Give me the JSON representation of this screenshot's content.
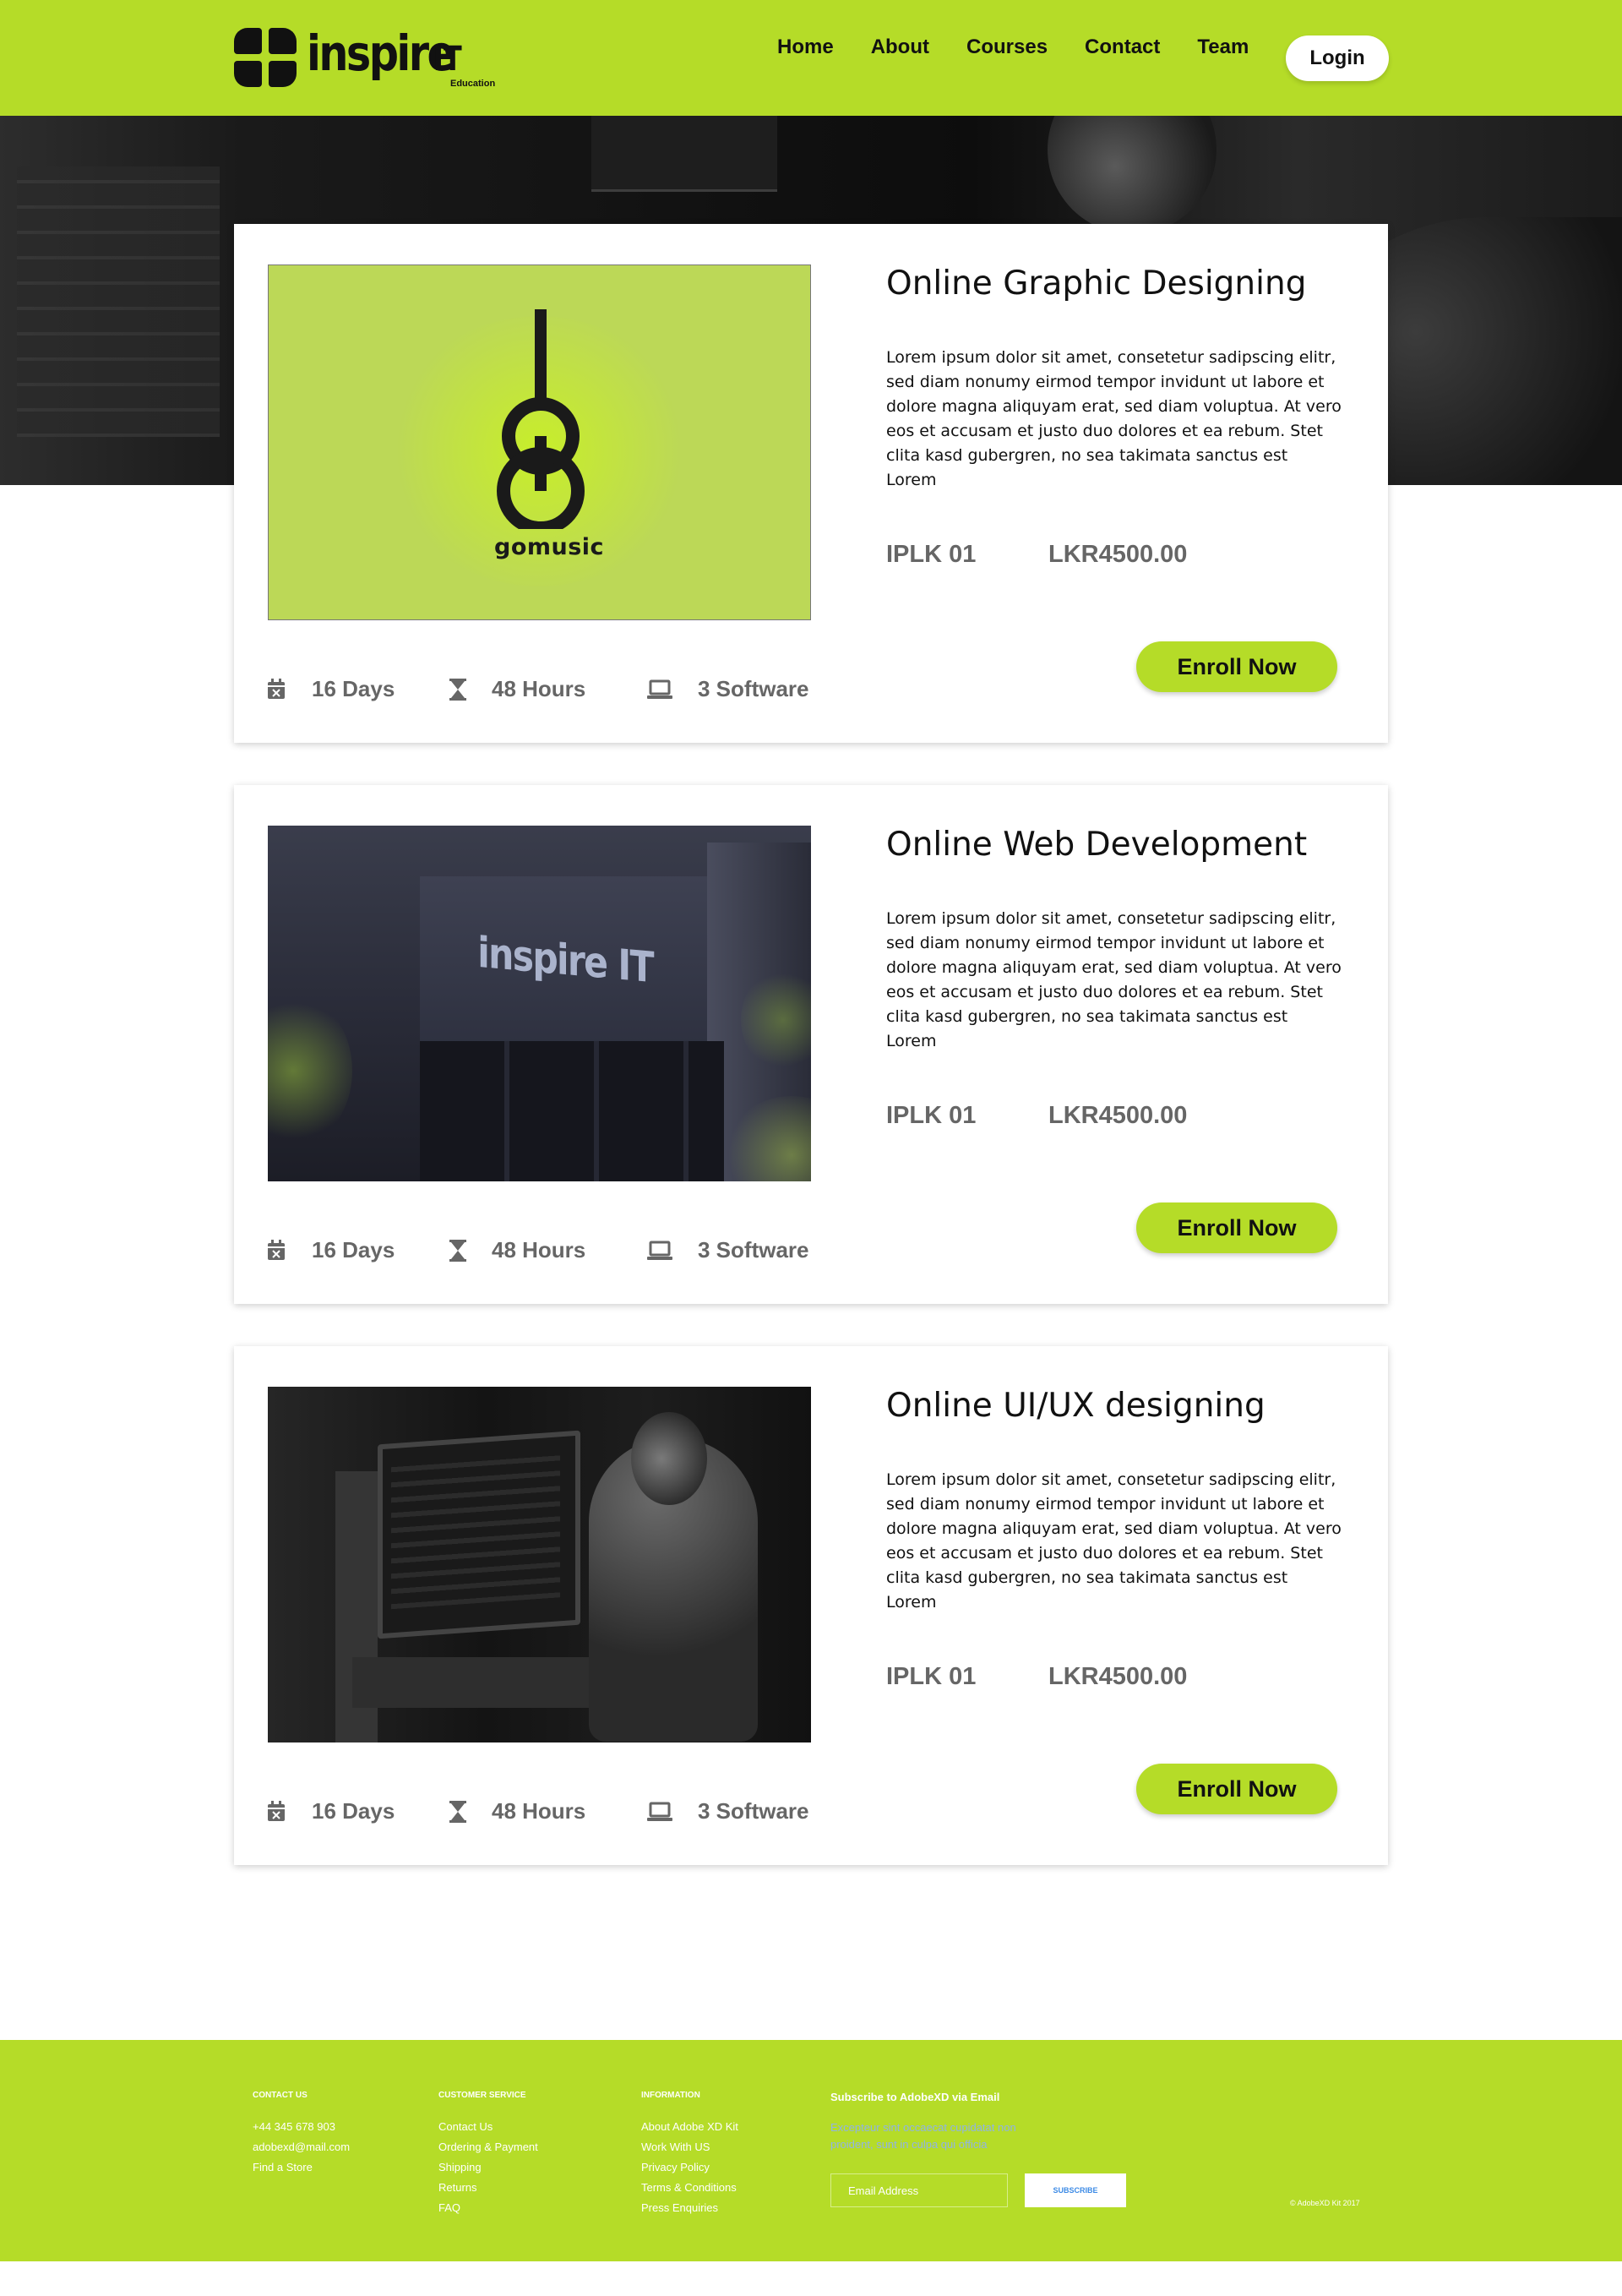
{
  "header": {
    "logo": {
      "word": "inspire",
      "suffix": "IT",
      "tagline": "Education"
    },
    "nav": [
      "Home",
      "About",
      "Courses",
      "Contact",
      "Team"
    ],
    "login_label": "Login",
    "brand_color": "#b5dc28"
  },
  "courses": [
    {
      "title": "Online Graphic Designing",
      "description": "Lorem ipsum dolor sit amet, consetetur sadipscing elitr, sed diam nonumy eirmod tempor invidunt ut labore et dolore magna aliquyam erat, sed diam voluptua. At vero eos et accusam et justo duo dolores et ea rebum. Stet clita kasd gubergren, no sea takimata sanctus est Lorem",
      "code": "IPLK 01",
      "price": "LKR4500.00",
      "enroll_label": "Enroll Now",
      "days": "16 Days",
      "hours": "48 Hours",
      "software": "3 Software",
      "image_label": "gomusic"
    },
    {
      "title": "Online Web Development",
      "description": "Lorem ipsum dolor sit amet, consetetur sadipscing elitr, sed diam nonumy eirmod tempor invidunt ut labore et dolore magna aliquyam erat, sed diam voluptua. At vero eos et accusam et justo duo dolores et ea rebum. Stet clita kasd gubergren, no sea takimata sanctus est Lorem",
      "code": "IPLK 01",
      "price": "LKR4500.00",
      "enroll_label": "Enroll Now",
      "days": "16 Days",
      "hours": "48 Hours",
      "software": "3 Software",
      "image_label": "inspire IT"
    },
    {
      "title": "Online UI/UX designing",
      "description": "Lorem ipsum dolor sit amet, consetetur sadipscing elitr, sed diam nonumy eirmod tempor invidunt ut labore et dolore magna aliquyam erat, sed diam voluptua. At vero eos et accusam et justo duo dolores et ea rebum. Stet clita kasd gubergren, no sea takimata sanctus est Lorem",
      "code": "IPLK 01",
      "price": "LKR4500.00",
      "enroll_label": "Enroll Now",
      "days": "16 Days",
      "hours": "48 Hours",
      "software": "3 Software"
    }
  ],
  "icons": {
    "days": "calendar-icon",
    "hours": "hourglass-icon",
    "software": "laptop-icon"
  },
  "footer": {
    "contact": {
      "heading": "CONTACT US",
      "items": [
        "+44 345 678 903",
        "adobexd@mail.com",
        "Find a Store"
      ]
    },
    "service": {
      "heading": "CUSTOMER SERVICE",
      "items": [
        "Contact Us",
        "Ordering & Payment",
        "Shipping",
        "Returns",
        "FAQ"
      ]
    },
    "information": {
      "heading": "INFORMATION",
      "items": [
        "About Adobe XD Kit",
        "Work With US",
        "Privacy Policy",
        "Terms & Conditions",
        "Press Enquiries"
      ]
    },
    "subscribe": {
      "title": "Subscribe to AdobeXD via Email",
      "text": "Excepteur sint occaecat cupidatat non proident, sunt in culpa qui officia",
      "email_placeholder": "Email Address",
      "button_label": "SUBSCRIBE"
    },
    "copyright": "© AdobeXD Kit 2017"
  }
}
